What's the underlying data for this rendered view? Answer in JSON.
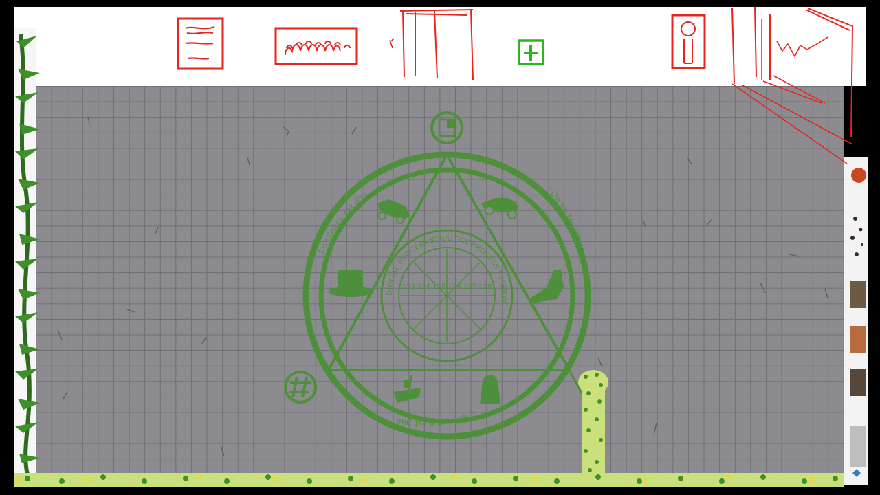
{
  "scene": {
    "colors": {
      "sigil": "#4e8f3b",
      "sketch_red": "#e8251c",
      "grid_bg": "#8c8c90",
      "grid_line": "#6d6d73",
      "vine": "#3f8f2a",
      "flower": "#f4d23a"
    }
  },
  "toolbar": {
    "items": [
      {
        "icon": "document-icon"
      },
      {
        "icon": "crowd-icon"
      },
      {
        "icon": "doorway-icon"
      },
      {
        "icon": "add-icon"
      },
      {
        "icon": "person-icon"
      },
      {
        "icon": "window-icon"
      }
    ]
  },
  "sigil": {
    "outer_text_left": "Le silence est d'or",
    "outer_text_right": "On ne résout pas ce qu'on ne peut",
    "outer_text_bottom": "L'univers n'est pas la plus",
    "inner_ring_text": "DIGITAL PROCESS STRATEGY PROCESS PASSION",
    "center_numbers": "123 124 125 126 127 128",
    "symbols": [
      "car-icon",
      "race-car-icon",
      "top-hat-icon",
      "boot-icon",
      "battleship-icon",
      "thimble-icon",
      "book-icon",
      "hashtag-icon"
    ]
  }
}
